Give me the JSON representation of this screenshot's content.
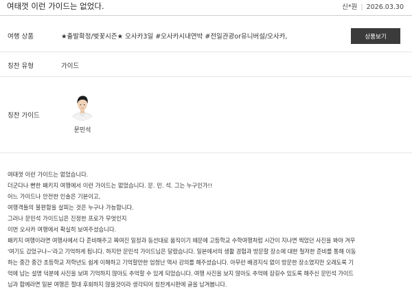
{
  "header": {
    "title": "여태껏 이런 가이드는 없었다.",
    "author": "신*원",
    "date": "2026.03.30"
  },
  "product": {
    "label": "여행 상품",
    "value": "★출발확정/벚꽃시즌★ 오사카3일 #오사카시내연박 #전일관광or유니버설/오사카,",
    "button_label": "상품보기"
  },
  "praise_type": {
    "label": "칭찬 유형",
    "value": "가이드"
  },
  "praise_guide": {
    "label": "칭찬 가이드",
    "name": "문민석",
    "avatar_icon": "guide-photo"
  },
  "body": {
    "lines": [
      "여태껏 이런 가이드는 없었습니다.",
      "더군다나 뻔한 패키지 여행에서 이런 가이드는 없었습니다. 문. 민. 석. 그는 누구인가!!",
      "어느 가이드나 안전한 인솔은 기본이고,",
      "여행객들의 불편함을 살피는 것은 누구나 가능합니다.",
      "그러나 문민석 가이드님은 진정한 프로가 무엇인지",
      "이번 오사카 여행에서 확실히 보여주셨습니다.",
      "패키지 여행이라면 여행사에서 다 준비해주고 짜여진 일정과 동선대로 움직이기 때문에 고등학교 수학여행처럼 시간이 지나면 찍었던 사진을 봐야 겨우",
      "'여기도 갔었구나~'라고 기억하게 됩니다. 하지만 문민석 가이드님은 달랐습니다. 일본에서의 생활 경험과 방문할 장소에 대한 철저한 준비를 통해 이동",
      "하는 중간 중간 초등학교 저학년도 쉽게 이해하고 기억할만한 엄청난 역사 강의를 해주셨습니다. 아무런 배경지식 없이 방문한 장소였지만 오래도록 기",
      "억에 남는 설명 덕분에 사진을 보며 기억하지 않아도 추억할 수 있게 되었습니다. 여행 사진을 보지 않아도 추억에 잠길수 있도록 해주신 문민석 가이드",
      "님과 함께라면 일본 여행은 절대 후회하지 않을것이라 생각되어 칭찬게시판에 글을 남겨봅니다."
    ]
  }
}
